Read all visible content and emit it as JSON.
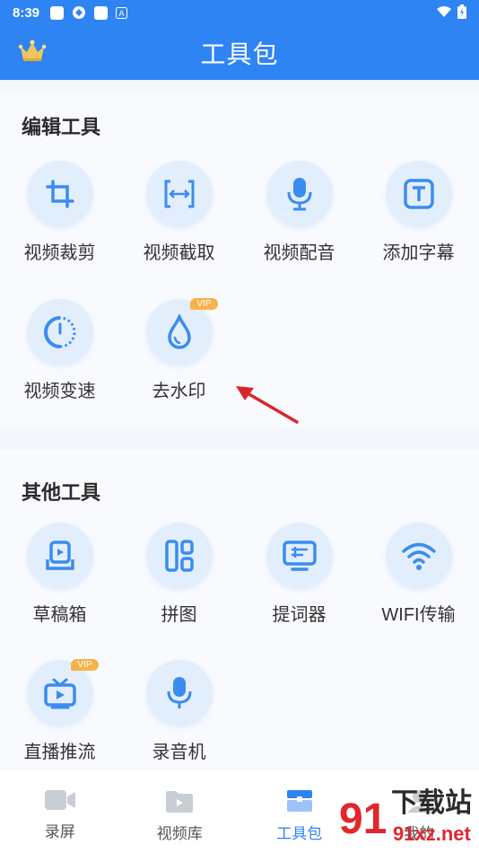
{
  "status": {
    "time": "8:39"
  },
  "header": {
    "title": "工具包"
  },
  "sections": [
    {
      "title": "编辑工具",
      "tools": [
        {
          "label": "视频裁剪",
          "icon": "crop-icon"
        },
        {
          "label": "视频截取",
          "icon": "trim-icon"
        },
        {
          "label": "视频配音",
          "icon": "microphone-icon"
        },
        {
          "label": "添加字幕",
          "icon": "text-icon"
        },
        {
          "label": "视频变速",
          "icon": "speed-dial-icon"
        },
        {
          "label": "去水印",
          "icon": "droplet-icon",
          "badge": "VIP"
        }
      ]
    },
    {
      "title": "其他工具",
      "tools": [
        {
          "label": "草稿箱",
          "icon": "drafts-icon"
        },
        {
          "label": "拼图",
          "icon": "collage-icon"
        },
        {
          "label": "提词器",
          "icon": "teleprompter-icon"
        },
        {
          "label": "WIFI传输",
          "icon": "wifi-icon"
        },
        {
          "label": "直播推流",
          "icon": "tv-icon",
          "badge": "VIP"
        },
        {
          "label": "录音机",
          "icon": "microphone-icon"
        }
      ]
    }
  ],
  "bottom_nav": [
    {
      "label": "录屏",
      "icon": "video-camera-icon"
    },
    {
      "label": "视频库",
      "icon": "video-folder-icon"
    },
    {
      "label": "工具包",
      "icon": "toolbox-icon",
      "active": true
    },
    {
      "label": "我的",
      "icon": "profile-icon"
    }
  ],
  "watermark": {
    "text_main": "下载站",
    "text_sub": "91xz.net",
    "digits": "91"
  },
  "colors": {
    "accent": "#2f84f3",
    "vip": "#f6b24b",
    "icon_bg": "#e3eefd",
    "arrow": "#d9262a"
  }
}
